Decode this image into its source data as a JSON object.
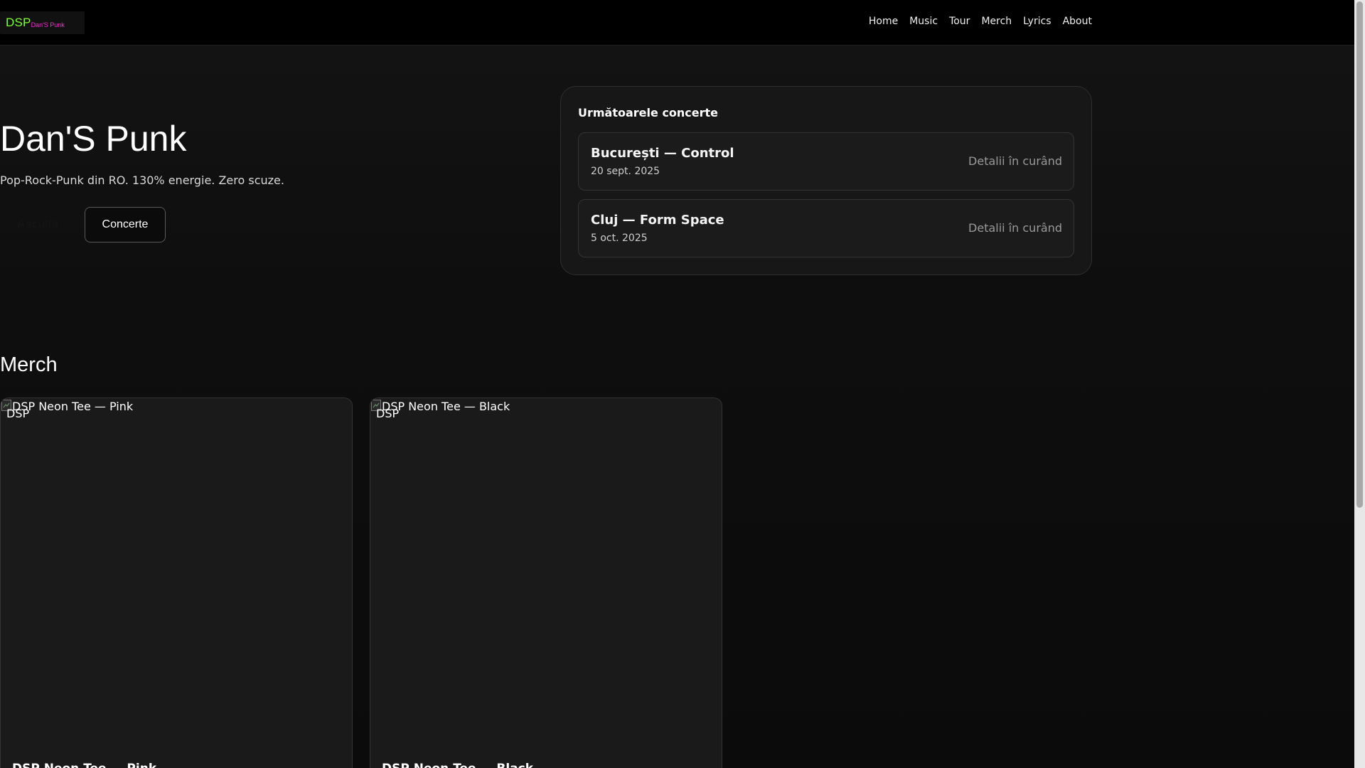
{
  "brand": {
    "main": "DSP",
    "sub": "Dan'S Punk",
    "main_color": "#7CFF2E",
    "sub_color": "#ff2bd6"
  },
  "nav": {
    "items": [
      "Home",
      "Music",
      "Tour",
      "Merch",
      "Lyrics",
      "About"
    ]
  },
  "hero": {
    "title": "Dan'S Punk",
    "subtitle": "Pop-Rock-Punk din RO. 130% energie. Zero scuze.",
    "listen_label": "Ascultă",
    "concerts_label": "Concerte"
  },
  "concerts": {
    "title": "Următoarele concerte",
    "items": [
      {
        "name": "București — Control",
        "date": "20 sept. 2025",
        "details": "Detalii în curând"
      },
      {
        "name": "Cluj — Form Space",
        "date": "5 oct. 2025",
        "details": "Detalii în curând"
      }
    ]
  },
  "merch": {
    "title": "Merch",
    "items": [
      {
        "alt": "DSP Neon Tee — Pink",
        "badge": "DSP",
        "name": "DSP Neon Tee — Pink"
      },
      {
        "alt": "DSP Neon Tee — Black",
        "badge": "DSP",
        "name": "DSP Neon Tee — Black"
      }
    ]
  },
  "icons": {
    "broken_image": "broken-image-icon"
  }
}
